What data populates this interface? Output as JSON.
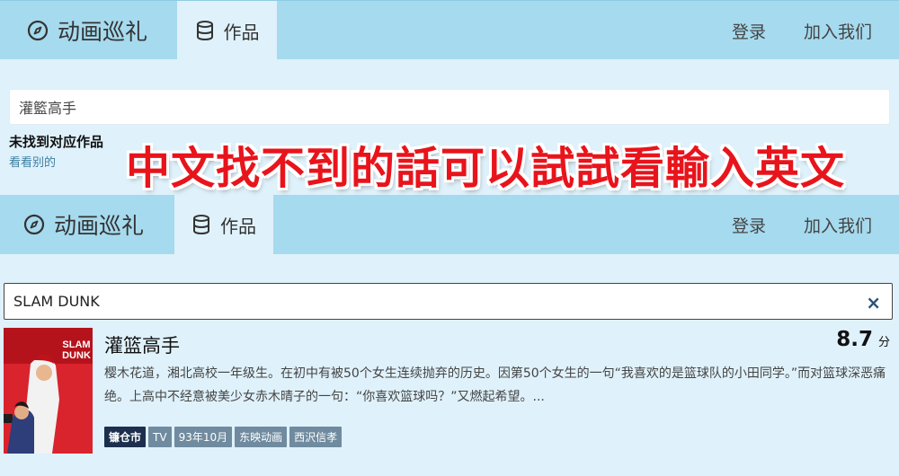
{
  "nav": {
    "brand": "动画巡礼",
    "works_tab": "作品",
    "login": "登录",
    "join": "加入我们"
  },
  "search_first": {
    "value": "灌籃高手",
    "not_found": "未找到对应作品",
    "look_other": "看看别的"
  },
  "overlay_text": "中文找不到的話可以試試看輸入英文",
  "search_second": {
    "value": "SLAM DUNK",
    "clear_icon": "×"
  },
  "result": {
    "title": "灌篮高手",
    "score": "8.7",
    "score_unit": "分",
    "description": "樱木花道，湘北高校一年级生。在初中有被50个女生连续抛弃的历史。因第50个女生的一句“我喜欢的是篮球队的小田同学。”而对篮球深恶痛绝。上高中不经意被美少女赤木晴子的一句：“你喜欢篮球吗？”又燃起希望。...",
    "tags": [
      "镰仓市",
      "TV",
      "93年10月",
      "东映动画",
      "西沢信孝"
    ],
    "poster_text": [
      "SLAM",
      "DUNK"
    ]
  },
  "colors": {
    "navbar": "#a6daee",
    "page": "#dff1fa",
    "overlay": "#e8141c",
    "tag_primary": "#1c2f4d",
    "tag": "#708b9f"
  }
}
